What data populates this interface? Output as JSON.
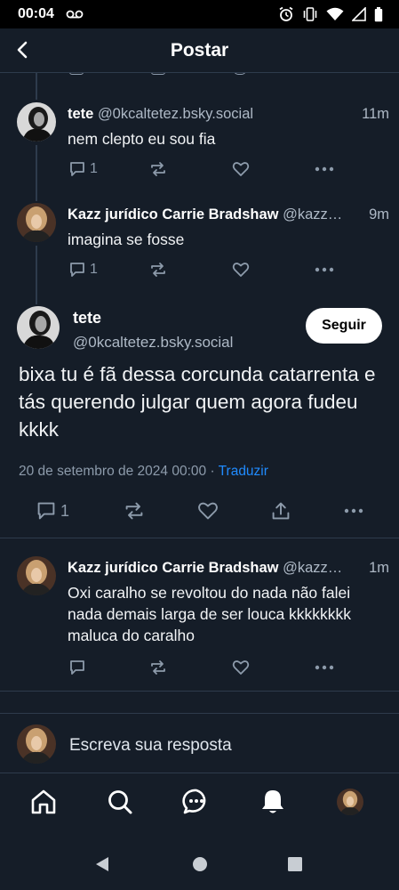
{
  "status_bar": {
    "time": "00:04"
  },
  "header": {
    "title": "Postar"
  },
  "posts": [
    {
      "name": "tete",
      "handle": "@0kcaltetez.bsky.social",
      "time": "11m",
      "text": "nem clepto eu sou fia",
      "reply_count": "1",
      "avatar": "tete"
    },
    {
      "name": "Kazz jurídico Carrie Bradshaw",
      "handle": "@kazz…",
      "time": "9m",
      "text": "imagina se fosse",
      "reply_count": "1",
      "avatar": "kazz"
    }
  ],
  "main_post": {
    "name": "tete",
    "handle": "@0kcaltetez.bsky.social",
    "follow_label": "Seguir",
    "text": "bixa tu é fã dessa corcunda catarrenta e tás querendo julgar quem agora fudeu kkkk",
    "date": "20 de setembro de 2024 00:00",
    "separator": " · ",
    "translate": "Traduzir",
    "reply_count": "1"
  },
  "replies": [
    {
      "name": "Kazz jurídico Carrie Bradshaw",
      "handle": "@kazz…",
      "time": "1m",
      "text": "Oxi caralho se revoltou do nada não falei nada demais larga de ser louca kkkkkkkk maluca do caralho",
      "avatar": "kazz"
    }
  ],
  "composer": {
    "placeholder": "Escreva sua resposta"
  },
  "colors": {
    "background": "#151d28",
    "border": "#2e3b4c",
    "accent": "#208bfe",
    "muted": "#8d9bab"
  },
  "bottom_nav": [
    "home-icon",
    "search-icon",
    "chat-icon",
    "bell-icon",
    "profile-avatar"
  ]
}
